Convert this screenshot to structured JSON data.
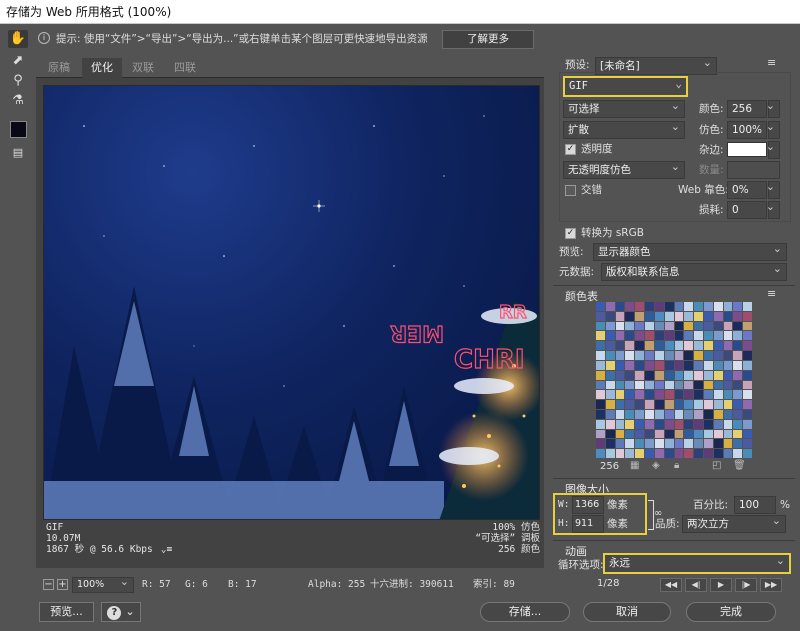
{
  "title": "存储为 Web 所用格式 (100%)",
  "hint": {
    "text": "提示: 使用“文件”>“导出”>“导出为...”或右键单击某个图层可更快速地导出资源",
    "learn_more": "了解更多"
  },
  "tabs": [
    "原稿",
    "优化",
    "双联",
    "四联"
  ],
  "canvas_text": {
    "line1": "MER",
    "line2": "CHRI",
    "line3": "RR"
  },
  "image_info": {
    "format": "GIF",
    "size": "10.07M",
    "time": "1867 秒 @ 56.6 Kbps",
    "dither_line": "100% 仿色",
    "palette_line": "“可选择” 调板",
    "colors_line": "256 颜色"
  },
  "status": {
    "zoom": "100%",
    "r": "R: 57",
    "g": "G: 6",
    "b": "B: 17",
    "alpha": "Alpha: 255",
    "hex": "十六进制: 390611",
    "index": "索引: 89"
  },
  "bottom_buttons": {
    "preview": "预览...",
    "help": "?",
    "save": "存储...",
    "cancel": "取消",
    "done": "完成"
  },
  "settings": {
    "preset_label": "预设:",
    "preset_value": "[未命名]",
    "format": "GIF",
    "reduction": "可选择",
    "colors_label": "颜色:",
    "colors_value": "256",
    "dither_algo": "扩散",
    "dither_label": "仿色:",
    "dither_value": "100%",
    "transparency": "透明度",
    "matte_label": "杂边:",
    "trans_dither": "无透明度仿色",
    "amount_label": "数量:",
    "interlace": "交错",
    "websnap_label": "Web 靠色:",
    "websnap_value": "0%",
    "lossy_label": "损耗:",
    "lossy_value": "0",
    "convert_srgb": "转换为 sRGB",
    "preview_label": "预览:",
    "preview_value": "显示器颜色",
    "metadata_label": "元数据:",
    "metadata_value": "版权和联系信息"
  },
  "color_table": {
    "title": "颜色表",
    "count": "256",
    "colors": [
      "#3a5cb0",
      "#c8a2b8",
      "#6b78c8",
      "#2f3f7a",
      "#a6c8e0",
      "#d6b040",
      "#4a8cb8",
      "#8f6ab0",
      "#1e2a5c",
      "#b8d0e8",
      "#5e3c7a",
      "#e0c8d8",
      "#3c6ea8",
      "#7a9ad0",
      "#2a4a8c",
      "#c0a070",
      "#6a8ab8",
      "#1c3064",
      "#9ab8d8",
      "#4c5aa0",
      "#d8e0f0",
      "#7c4c8c",
      "#2e5c9c",
      "#b0a0c8",
      "#5a7ab8",
      "#e4d070",
      "#3a4a7c",
      "#8cb0d8",
      "#a04c6c",
      "#4c8cc0",
      "#1a2850",
      "#c8d8ec"
    ]
  },
  "image_size": {
    "title": "图像大小",
    "w_label": "W:",
    "w_value": "1366",
    "h_label": "H:",
    "h_value": "911",
    "unit": "像素",
    "percent_label": "百分比:",
    "percent_value": "100",
    "percent_unit": "%",
    "quality_label": "品质:",
    "quality_value": "两次立方"
  },
  "animation": {
    "title": "动画",
    "loop_label": "循环选项:",
    "loop_value": "永远",
    "frame": "1/28"
  },
  "colors": {
    "highlight": "#e6d040",
    "panel_bg": "#535353",
    "accent_blue": "#0f2460"
  }
}
